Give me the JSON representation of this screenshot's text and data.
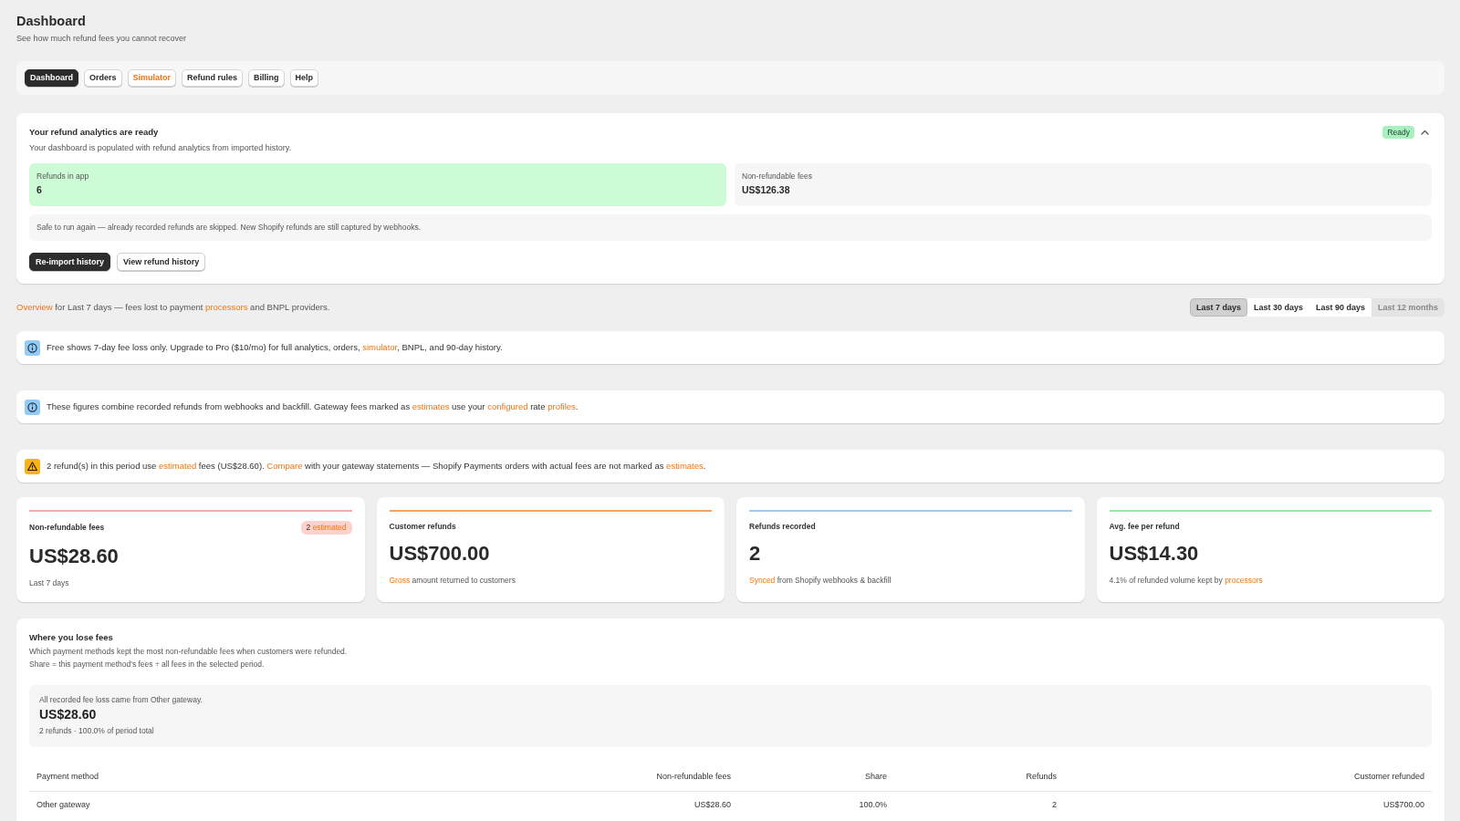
{
  "page": {
    "title": "Dashboard",
    "subtitle": "See how much refund fees you cannot recover"
  },
  "nav_tabs": [
    {
      "label": "Dashboard",
      "selected": true,
      "kind": "plain"
    },
    {
      "label": "Orders",
      "selected": false,
      "kind": "plain"
    },
    {
      "label": "Simulator",
      "selected": false,
      "kind": "accent"
    },
    {
      "label": "Refund rules",
      "selected": false,
      "kind": "plain"
    },
    {
      "label": "Billing",
      "selected": false,
      "kind": "plain"
    },
    {
      "label": "Help",
      "selected": false,
      "kind": "plain"
    }
  ],
  "import_card": {
    "title": "Your refund analytics are ready",
    "status_badge": "Ready",
    "expanded": true,
    "description": "Your dashboard is populated with refund analytics from imported history.",
    "metrics": [
      {
        "label": "Refunds in app",
        "value": "6",
        "kind": "success"
      },
      {
        "label": "Non-refundable fees",
        "value": "US$126.38",
        "kind": "neutral"
      }
    ],
    "note": "Safe to run again — already recorded refunds are skipped. New Shopify refunds are still captured by webhooks.",
    "buttons": [
      {
        "label": "Re-import history",
        "kind": "primary"
      },
      {
        "label": "View refund history",
        "kind": "secondary"
      }
    ]
  },
  "overview": {
    "segments": [
      {
        "text": "Overview",
        "kind": "link"
      },
      {
        "text": " for Last 7 days — fees lost to payment ",
        "kind": "text"
      },
      {
        "text": "processors",
        "kind": "link"
      },
      {
        "text": " and BNPL providers.",
        "kind": "text"
      }
    ]
  },
  "period_selector": [
    {
      "label": "Last 7 days",
      "selected": true,
      "disabled": false
    },
    {
      "label": "Last 30 days",
      "selected": false,
      "disabled": false
    },
    {
      "label": "Last 90 days",
      "selected": false,
      "disabled": false
    },
    {
      "label": "Last 12 months",
      "selected": false,
      "disabled": true
    }
  ],
  "banners": [
    {
      "kind": "info",
      "segments": [
        {
          "text": "Free shows 7-day fee loss only. Upgrade to Pro ($10/mo) for full analytics, orders, ",
          "kind": "text"
        },
        {
          "text": "simulator",
          "kind": "link"
        },
        {
          "text": ", BNPL, and 90-day history.",
          "kind": "text"
        }
      ]
    },
    {
      "kind": "info",
      "segments": [
        {
          "text": "These figures combine recorded refunds from webhooks and backfill. Gateway fees marked as ",
          "kind": "text"
        },
        {
          "text": "estimates",
          "kind": "link"
        },
        {
          "text": " use your ",
          "kind": "text"
        },
        {
          "text": "configured",
          "kind": "link"
        },
        {
          "text": " rate ",
          "kind": "text"
        },
        {
          "text": "profiles",
          "kind": "link"
        },
        {
          "text": ".",
          "kind": "text"
        }
      ]
    },
    {
      "kind": "warning",
      "segments": [
        {
          "text": "2 refund(s) in this period use ",
          "kind": "text"
        },
        {
          "text": "estimated",
          "kind": "link"
        },
        {
          "text": " fees (US$28.60). ",
          "kind": "text"
        },
        {
          "text": "Compare",
          "kind": "link"
        },
        {
          "text": " with your gateway statements — Shopify Payments orders with actual fees are not marked as ",
          "kind": "text"
        },
        {
          "text": "estimates",
          "kind": "link"
        },
        {
          "text": ".",
          "kind": "text"
        }
      ]
    }
  ],
  "stat_cards": [
    {
      "label": "Non-refundable fees",
      "color": "#f6a9a9",
      "badge": [
        {
          "text": "2 ",
          "kind": "text"
        },
        {
          "text": "estimated",
          "kind": "link"
        }
      ],
      "value": "US$28.60",
      "caption": [
        {
          "text": "Last 7 days",
          "kind": "text"
        }
      ]
    },
    {
      "label": "Customer refunds",
      "color": "#f5a35c",
      "value": "US$700.00",
      "caption": [
        {
          "text": "Gross",
          "kind": "link"
        },
        {
          "text": " amount returned to customers",
          "kind": "text"
        }
      ]
    },
    {
      "label": "Refunds recorded",
      "color": "#9dcbf5",
      "value": "2",
      "caption": [
        {
          "text": "Synced",
          "kind": "link"
        },
        {
          "text": " from Shopify webhooks & backfill",
          "kind": "text"
        }
      ]
    },
    {
      "label": "Avg. fee per refund",
      "color": "#98e8a8",
      "value": "US$14.30",
      "caption": [
        {
          "text": "4.1% of refunded volume kept by ",
          "kind": "text"
        },
        {
          "text": "processors",
          "kind": "link"
        }
      ]
    }
  ],
  "fee_breakdown": {
    "title": "Where you lose fees",
    "description": "Which payment methods kept the most non-refundable fees when customers were refunded.",
    "formula_note": "Share = this payment method's fees ÷ all fees in the selected period.",
    "summary": {
      "caption": "All recorded fee loss came from Other gateway.",
      "amount": "US$28.60",
      "detail": "2 refunds · 100.0% of period total"
    },
    "table": {
      "columns": [
        "Payment method",
        "Non-refundable fees",
        "Share",
        "Refunds",
        "Customer refunded"
      ],
      "rows": [
        [
          "Other gateway",
          "US$28.60",
          "100.0%",
          "2",
          "US$700.00"
        ]
      ]
    }
  }
}
